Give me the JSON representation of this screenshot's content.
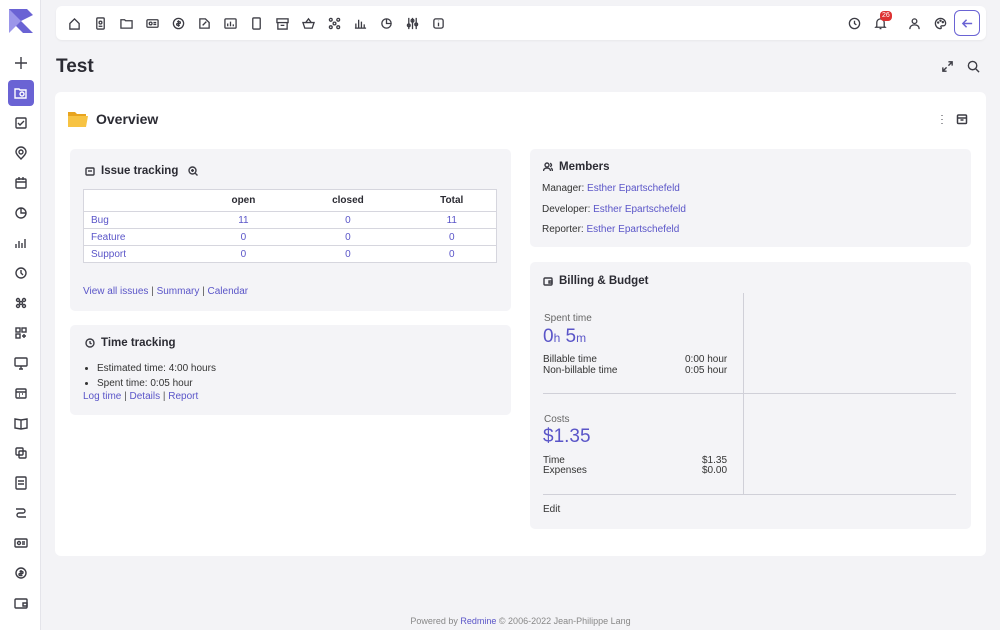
{
  "app": {
    "project_title": "Test",
    "sidebar_icons": [
      "logo",
      "plus-icon",
      "search-folder-icon",
      "checklist-icon",
      "location-icon",
      "calendar-icon",
      "pie-icon",
      "bar-chart-icon",
      "clock-icon",
      "apps-icon",
      "grid-add-icon",
      "monitor-icon",
      "calendar-grid-icon",
      "book-icon",
      "copy-icon",
      "document-icon",
      "routes-icon",
      "card-icon",
      "coin-icon",
      "wallet-icon"
    ]
  },
  "topbar": {
    "icons": [
      "home-icon",
      "contact-icon",
      "folder-icon",
      "id-card-icon",
      "dollar-icon",
      "file-export-icon",
      "chart-file-icon",
      "mobile-icon",
      "archive-icon",
      "basket-icon",
      "network-icon",
      "stats-icon",
      "pie-chart-icon",
      "sliders-icon",
      "info-icon"
    ],
    "right_icons": [
      "history-icon",
      "bell-icon",
      "user-icon",
      "palette-icon"
    ],
    "notification_count": "26"
  },
  "overview": {
    "title": "Overview"
  },
  "issue_tracking": {
    "title": "Issue tracking",
    "columns": [
      "",
      "open",
      "closed",
      "Total"
    ],
    "rows": [
      {
        "tracker": "Bug",
        "open": "11",
        "closed": "0",
        "total": "11"
      },
      {
        "tracker": "Feature",
        "open": "0",
        "closed": "0",
        "total": "0"
      },
      {
        "tracker": "Support",
        "open": "0",
        "closed": "0",
        "total": "0"
      }
    ],
    "links": [
      "View all issues",
      "Summary",
      "Calendar"
    ]
  },
  "time_tracking": {
    "title": "Time tracking",
    "estimated": "Estimated time: 4:00 hours",
    "spent": "Spent time: 0:05 hour",
    "links": [
      "Log time",
      "Details",
      "Report"
    ]
  },
  "members": {
    "title": "Members",
    "rows": [
      {
        "role": "Manager:",
        "name": "Esther Epartschefeld"
      },
      {
        "role": "Developer:",
        "name": "Esther Epartschefeld"
      },
      {
        "role": "Reporter:",
        "name": "Esther Epartschefeld"
      }
    ]
  },
  "billing": {
    "title": "Billing & Budget",
    "spent_label": "Spent time",
    "spent_h": "0",
    "spent_h_unit": "h",
    "spent_m": "5",
    "spent_m_unit": "m",
    "billable_label": "Billable time",
    "billable_value": "0:00 hour",
    "nonbillable_label": "Non-billable time",
    "nonbillable_value": "0:05 hour",
    "costs_label": "Costs",
    "costs_value": "$1.35",
    "time_label": "Time",
    "time_value": "$1.35",
    "expenses_label": "Expenses",
    "expenses_value": "$0.00",
    "edit": "Edit"
  },
  "footer": {
    "prefix": "Powered by",
    "link": "Redmine",
    "suffix": "© 2006-2022 Jean-Philippe Lang"
  }
}
